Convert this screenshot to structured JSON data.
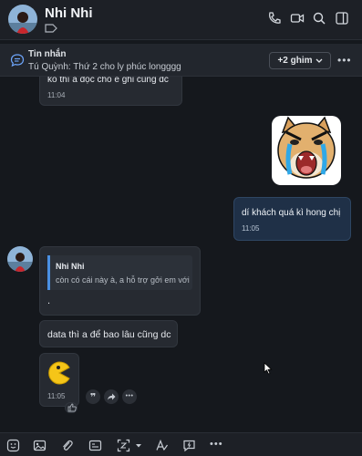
{
  "header": {
    "name": "Nhi Nhi"
  },
  "pinned": {
    "title": "Tin nhắn",
    "text": "Tú Quỳnh: Thứ 2 cho ly phúc longggg",
    "pin_button": "+2 ghim"
  },
  "messages": {
    "m1_text": "ko thì a đọc cho e ghi cũng dc",
    "m1_time": "11:04",
    "m2_text": "dí khách quá kì hong chị",
    "m2_time": "11:05",
    "m3_quote_name": "Nhi Nhi",
    "m3_quote_text": "còn có cái này à, a hỗ trợ gởi em với",
    "m3_text": ".",
    "m4_text": "data thì a để bao lâu cũng dc",
    "m5_time": "11:05"
  },
  "colors": {
    "accent_outgoing": "#1f3047",
    "quote_bar": "#4a90e2"
  }
}
